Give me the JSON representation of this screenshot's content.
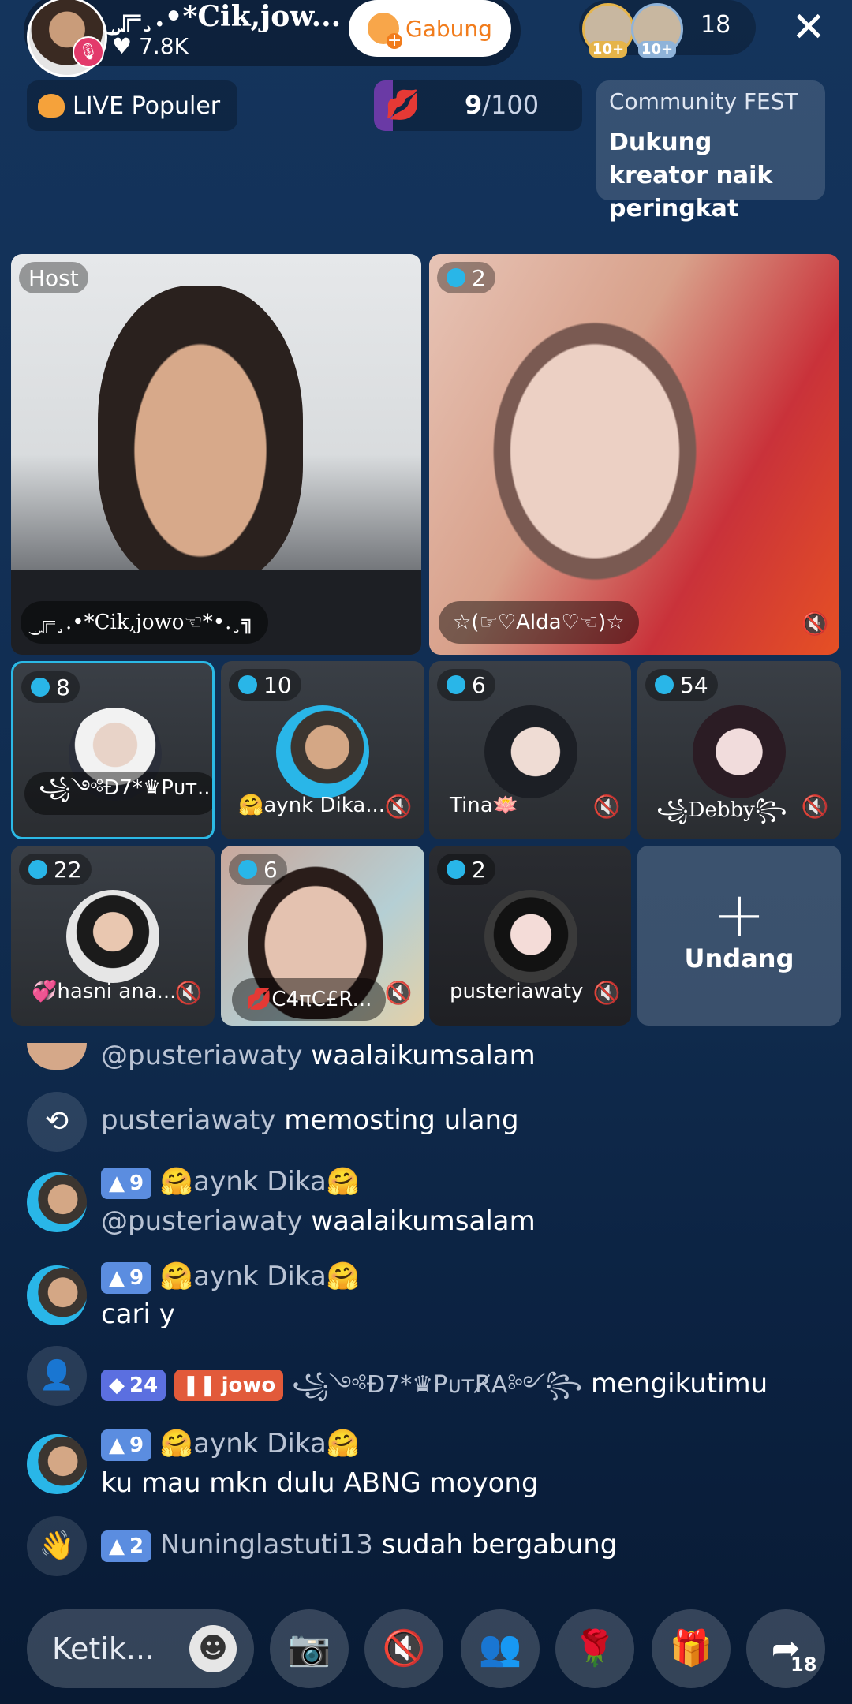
{
  "header": {
    "host_name": "╔ۣ͜¸.•*Cik,jow...",
    "likes": "7.8K",
    "join_label": "Gabung",
    "viewer_badges": [
      "10+",
      "10+"
    ],
    "viewer_count": "18",
    "close_icon": "close-icon"
  },
  "promo": {
    "live_popular": "LIVE Populer",
    "goal_current": "9",
    "goal_total": "/100",
    "goal_fraction": 0.09,
    "fest_title": "Community FEST",
    "fest_body": "Dukung kreator naik peringkat"
  },
  "grid": {
    "host": {
      "tag": "Host",
      "name": "╔ۣ͜¸.•*Cik,jowo☜*•.¸╗"
    },
    "big2": {
      "count": "2",
      "name": "☆(☞♡Alda♡☜)☆"
    },
    "small": [
      {
        "count": "8",
        "name": "꧁༺Đ7*♛Pᴜᴛ..."
      },
      {
        "count": "10",
        "name": "🤗aynk Dika..."
      },
      {
        "count": "6",
        "name": "Tina🪷"
      },
      {
        "count": "54",
        "name": "꧁Debby꧂"
      },
      {
        "count": "22",
        "name": "💞hasni ana..."
      },
      {
        "count": "6",
        "name": "💋C4πC£R..."
      },
      {
        "count": "2",
        "name": "pusteriawaty"
      }
    ],
    "invite_label": "Undang"
  },
  "chat": [
    {
      "user": "@pusteriawaty",
      "text": "waalaikumsalam"
    },
    {
      "user": "pusteriawaty",
      "text": "memosting ulang"
    },
    {
      "level": "9",
      "user": "🤗aynk Dika🤗",
      "line2_user": "@pusteriawaty",
      "line2_text": "waalaikumsalam"
    },
    {
      "level": "9",
      "user": "🤗aynk Dika🤗",
      "line2_text": "cari y"
    },
    {
      "level": "24",
      "fan": "jowo",
      "user": "꧁༺Đ7*♛PᴜᴛR̸A༻꧂",
      "text": "mengikutimu"
    },
    {
      "level": "9",
      "user": "🤗aynk Dika🤗",
      "line2_text": "ku mau mkn dulu ABNG moyong"
    },
    {
      "level": "2",
      "user": "Nuninglastuti13",
      "text": "sudah bergabung"
    }
  ],
  "bottom": {
    "input_placeholder": "Ketik...",
    "share_count": "18"
  }
}
